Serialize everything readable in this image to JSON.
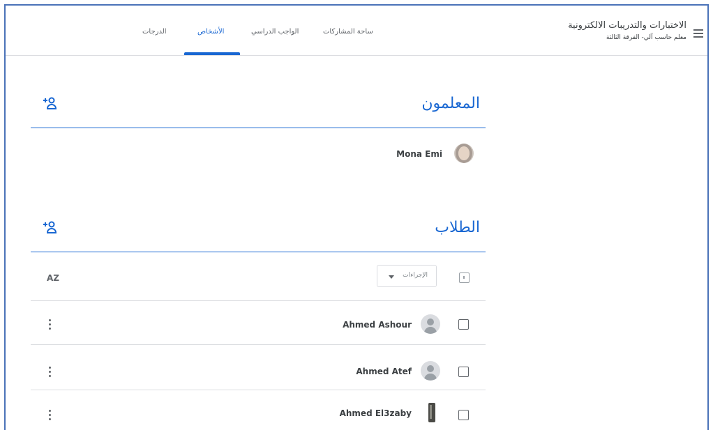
{
  "header": {
    "class_title": "الاختبارات والتدريبات الالكترونية",
    "class_subtitle": "معلم حاسب آلي- الفرقة الثالثة",
    "tabs": [
      {
        "label": "ساحة المشاركات",
        "active": false
      },
      {
        "label": "الواجب الدراسي",
        "active": false
      },
      {
        "label": "الأشخاص",
        "active": true
      },
      {
        "label": "الدرجات",
        "active": false
      }
    ]
  },
  "teachers": {
    "title": "المعلمون",
    "people": [
      {
        "name": "Mona Emi",
        "avatar": "photo"
      }
    ]
  },
  "students": {
    "title": "الطلاب",
    "actions_label": "الإجراءات",
    "sort_label": "AZ",
    "people": [
      {
        "name": "Ahmed Ashour",
        "avatar": "generic"
      },
      {
        "name": "Ahmed Atef",
        "avatar": "generic"
      },
      {
        "name": "Ahmed El3zaby",
        "avatar": "phone"
      }
    ]
  },
  "colors": {
    "accent": "#1967d2",
    "frame": "#4a72b8",
    "divider": "#dadce0"
  }
}
